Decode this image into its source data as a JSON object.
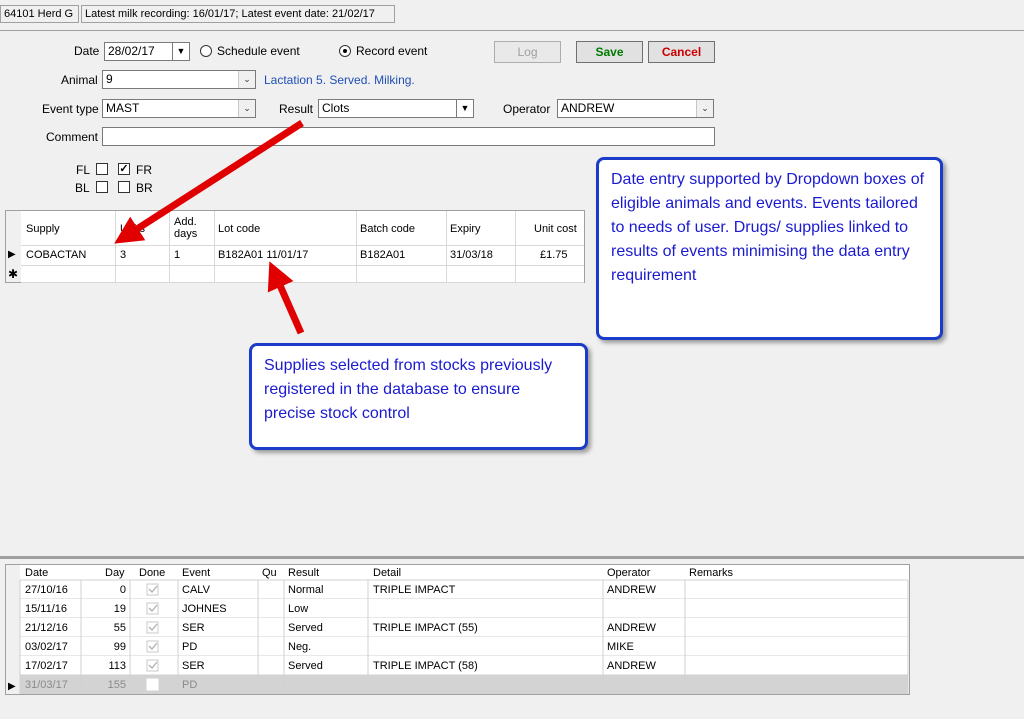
{
  "statusbar": {
    "herd": "64101 Herd G",
    "recording": "Latest milk recording: 16/01/17; Latest event date: 21/02/17"
  },
  "form": {
    "date_label": "Date",
    "date_value": "28/02/17",
    "schedule_label": "Schedule event",
    "record_label": "Record event",
    "selected_mode": "Record event",
    "log_label": "Log",
    "save_label": "Save",
    "cancel_label": "Cancel",
    "animal_label": "Animal",
    "animal_value": "9",
    "animal_info": "Lactation 5. Served. Milking.",
    "event_type_label": "Event type",
    "event_type_value": "MAST",
    "result_label": "Result",
    "result_value": "Clots",
    "operator_label": "Operator",
    "operator_value": "ANDREW",
    "comment_label": "Comment",
    "comment_value": "",
    "quarters": [
      {
        "label": "FL",
        "checked": false
      },
      {
        "label": "FR",
        "checked": true
      },
      {
        "label": "BL",
        "checked": false
      },
      {
        "label": "BR",
        "checked": false
      }
    ]
  },
  "supplies_grid": {
    "headers": [
      "Supply",
      "Units",
      "Add. days",
      "Lot code",
      "Batch code",
      "Expiry",
      "Unit cost"
    ],
    "rows": [
      [
        "COBACTAN",
        "3",
        "1",
        "B182A01 11/01/17",
        "B182A01",
        "31/03/18",
        "£1.75"
      ]
    ]
  },
  "events_grid": {
    "headers": [
      "Date",
      "Day",
      "Done",
      "Event",
      "Qu",
      "Result",
      "Detail",
      "Operator",
      "Remarks"
    ],
    "rows": [
      {
        "date": "27/10/16",
        "day": "0",
        "done": true,
        "event": "CALV",
        "qu": "",
        "result": "Normal",
        "detail": "TRIPLE IMPACT",
        "operator": "ANDREW",
        "remarks": ""
      },
      {
        "date": "15/11/16",
        "day": "19",
        "done": true,
        "event": "JOHNES",
        "qu": "",
        "result": "Low",
        "detail": "",
        "operator": "",
        "remarks": ""
      },
      {
        "date": "21/12/16",
        "day": "55",
        "done": true,
        "event": "SER",
        "qu": "",
        "result": "Served",
        "detail": "TRIPLE IMPACT (55)",
        "operator": "ANDREW",
        "remarks": ""
      },
      {
        "date": "03/02/17",
        "day": "99",
        "done": true,
        "event": "PD",
        "qu": "",
        "result": "Neg.",
        "detail": "",
        "operator": "MIKE",
        "remarks": ""
      },
      {
        "date": "17/02/17",
        "day": "113",
        "done": true,
        "event": "SER",
        "qu": "",
        "result": "Served",
        "detail": "TRIPLE IMPACT (58)",
        "operator": "ANDREW",
        "remarks": ""
      },
      {
        "date": "31/03/17",
        "day": "155",
        "done": false,
        "event": "PD",
        "qu": "",
        "result": "",
        "detail": "",
        "operator": "",
        "remarks": ""
      }
    ]
  },
  "callouts": {
    "right": "Date entry supported by Dropdown boxes of eligible animals and events. Events tailored to needs of user. Drugs/ supplies linked to results of events minimising the data entry requirement",
    "middle": "Supplies selected from stocks previously registered in the database to ensure precise stock control"
  },
  "colors": {
    "arrow": "#e00000",
    "callout_border": "#1a3cc8",
    "callout_text": "#1a1ad0",
    "link_text": "#1f4fb5",
    "save": "#007a00",
    "cancel": "#cc0000"
  }
}
